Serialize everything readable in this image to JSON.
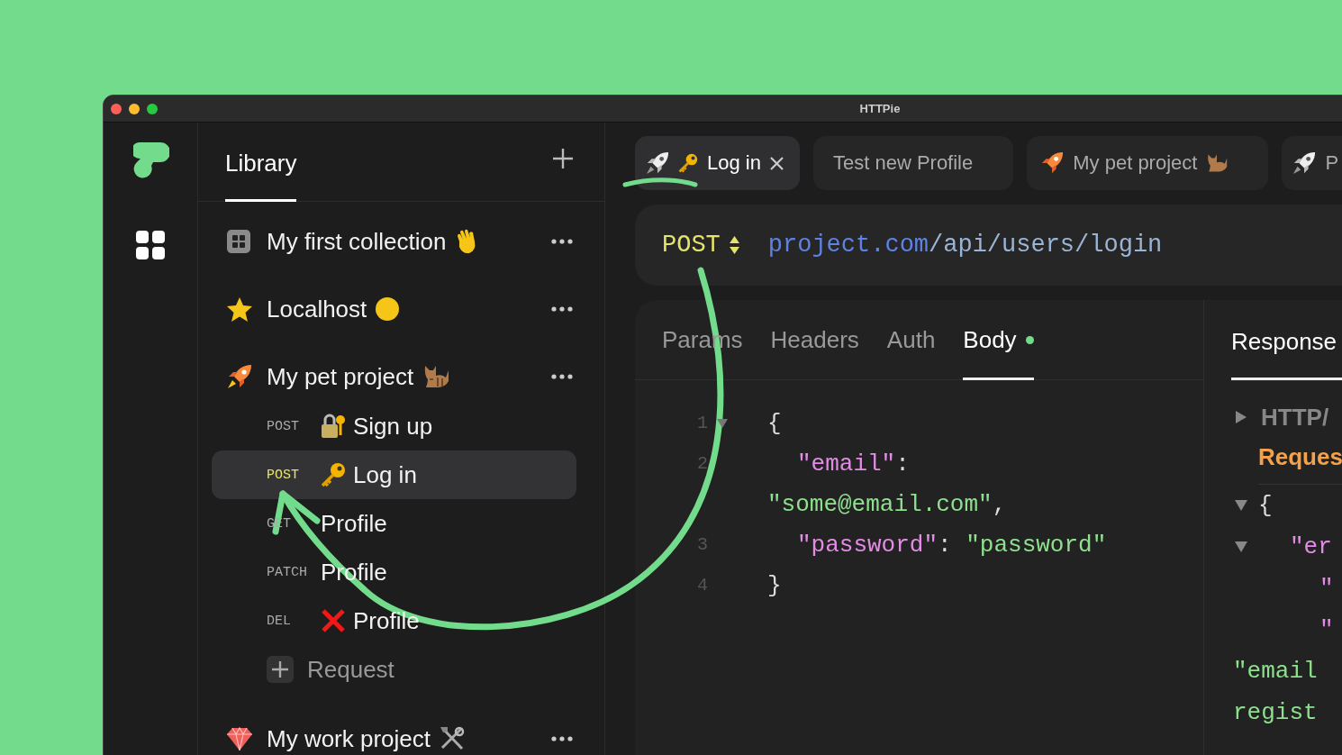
{
  "window": {
    "title": "HTTPie"
  },
  "sidebar": {
    "title": "Library",
    "collections": [
      {
        "name": "My first collection"
      },
      {
        "name": "Localhost"
      },
      {
        "name": "My pet project",
        "children": [
          {
            "method": "POST",
            "name": "Sign up",
            "selected": false
          },
          {
            "method": "POST",
            "name": "Log in",
            "selected": true
          },
          {
            "method": "GET",
            "name": "Profile",
            "selected": false
          },
          {
            "method": "PATCH",
            "name": "Profile",
            "selected": false
          },
          {
            "method": "DEL",
            "name": "Profile",
            "selected": false
          }
        ],
        "add_label": "Request"
      },
      {
        "name": "My work project"
      }
    ]
  },
  "tabs": [
    {
      "label": "Log in",
      "selected": true
    },
    {
      "label": "Test new Profile",
      "selected": false
    },
    {
      "label": "My pet project",
      "selected": false
    },
    {
      "label": "P",
      "selected": false
    }
  ],
  "request": {
    "method": "POST",
    "host": "project.com",
    "path": "/api/users/login"
  },
  "request_tabs": [
    {
      "label": "Params",
      "selected": false,
      "dot": false
    },
    {
      "label": "Headers",
      "selected": false,
      "dot": false
    },
    {
      "label": "Auth",
      "selected": false,
      "dot": false
    },
    {
      "label": "Body",
      "selected": true,
      "dot": true
    }
  ],
  "body": [
    {
      "number": "1",
      "kind": "top",
      "fold": true,
      "tokens": [
        {
          "kind": "punct",
          "text": "{"
        }
      ]
    },
    {
      "number": "2",
      "kind": "member",
      "fold": false,
      "tokens": [
        {
          "kind": "key",
          "text": "\"email\""
        },
        {
          "kind": "punct",
          "text": ":"
        }
      ]
    },
    {
      "kind": "top",
      "fold": false,
      "tokens": [
        {
          "kind": "string",
          "text": "\"some@email.com\""
        },
        {
          "kind": "punct",
          "text": ","
        }
      ]
    },
    {
      "number": "3",
      "kind": "member",
      "fold": false,
      "tokens": [
        {
          "kind": "key",
          "text": "\"password\""
        },
        {
          "kind": "punct",
          "text": ": "
        },
        {
          "kind": "string",
          "text": "\"password\""
        }
      ]
    },
    {
      "number": "4",
      "kind": "top",
      "fold": false,
      "tokens": [
        {
          "kind": "punct",
          "text": "}"
        }
      ]
    }
  ],
  "response": {
    "tab": "Response",
    "tab_selected": true,
    "status": "HTTP/",
    "status_expanded": false,
    "label": "Reques",
    "rows": [
      {
        "kind": "top",
        "fold": true,
        "tokens": [
          {
            "kind": "punct",
            "text": "{"
          }
        ]
      },
      {
        "kind": "member",
        "fold": true,
        "tokens": [
          {
            "kind": "key",
            "text": "\"er"
          }
        ]
      },
      {
        "kind": "nested",
        "fold": false,
        "tokens": [
          {
            "kind": "key",
            "text": "\""
          }
        ]
      },
      {
        "kind": "nested",
        "fold": false,
        "tokens": [
          {
            "kind": "key",
            "text": "\""
          }
        ]
      },
      {
        "kind": "wrap",
        "fold": false,
        "tokens": [
          {
            "kind": "string",
            "text": "\"email"
          }
        ]
      },
      {
        "kind": "wrap",
        "fold": false,
        "tokens": [
          {
            "kind": "string",
            "text": "regist"
          }
        ]
      }
    ]
  }
}
